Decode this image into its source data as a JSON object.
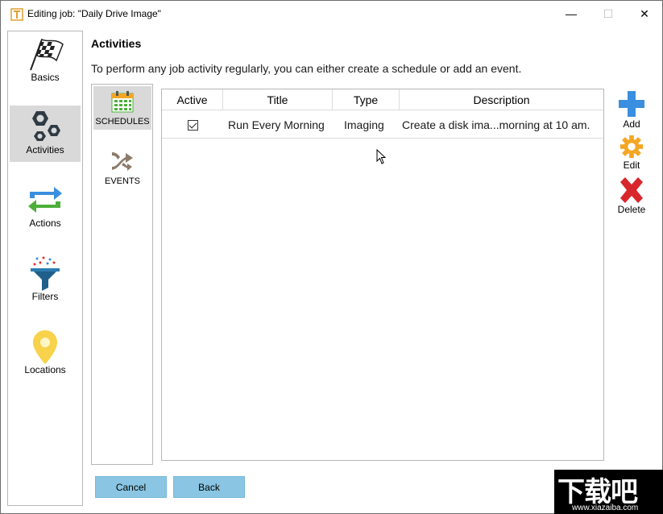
{
  "window": {
    "title": "Editing job: \"Daily Drive Image\"",
    "minimize_glyph": "—",
    "maximize_glyph": "☐",
    "close_glyph": "✕"
  },
  "nav": {
    "items": [
      {
        "label": "Basics",
        "icon": "checkered-flag-icon",
        "selected": false
      },
      {
        "label": "Activities",
        "icon": "hexagon-nuts-icon",
        "selected": true
      },
      {
        "label": "Actions",
        "icon": "swap-arrows-icon",
        "selected": false
      },
      {
        "label": "Filters",
        "icon": "funnel-icon",
        "selected": false
      },
      {
        "label": "Locations",
        "icon": "map-pin-icon",
        "selected": false
      }
    ]
  },
  "main": {
    "heading": "Activities",
    "subtitle": "To perform any job activity regularly, you can either create a schedule or add an event."
  },
  "tabs": [
    {
      "label": "SCHEDULES",
      "icon": "calendar-icon",
      "selected": true
    },
    {
      "label": "EVENTS",
      "icon": "fork-arrow-icon",
      "selected": false
    }
  ],
  "table": {
    "columns": [
      "Active",
      "Title",
      "Type",
      "Description"
    ],
    "rows": [
      {
        "active": true,
        "title": "Run Every Morning",
        "type": "Imaging",
        "description": "Create a disk ima...morning at 10 am."
      }
    ]
  },
  "actions": {
    "add": "Add",
    "edit": "Edit",
    "delete": "Delete"
  },
  "footer": {
    "cancel": "Cancel",
    "back": "Back"
  },
  "watermark": {
    "big": "下载吧",
    "small": "www.xiazaiba.com"
  },
  "colors": {
    "selected_bg": "#d9d9d9",
    "button_bg": "#8ac6e3",
    "add_blue": "#3b8fe0",
    "edit_orange": "#f5a623",
    "delete_red": "#d9262c"
  }
}
